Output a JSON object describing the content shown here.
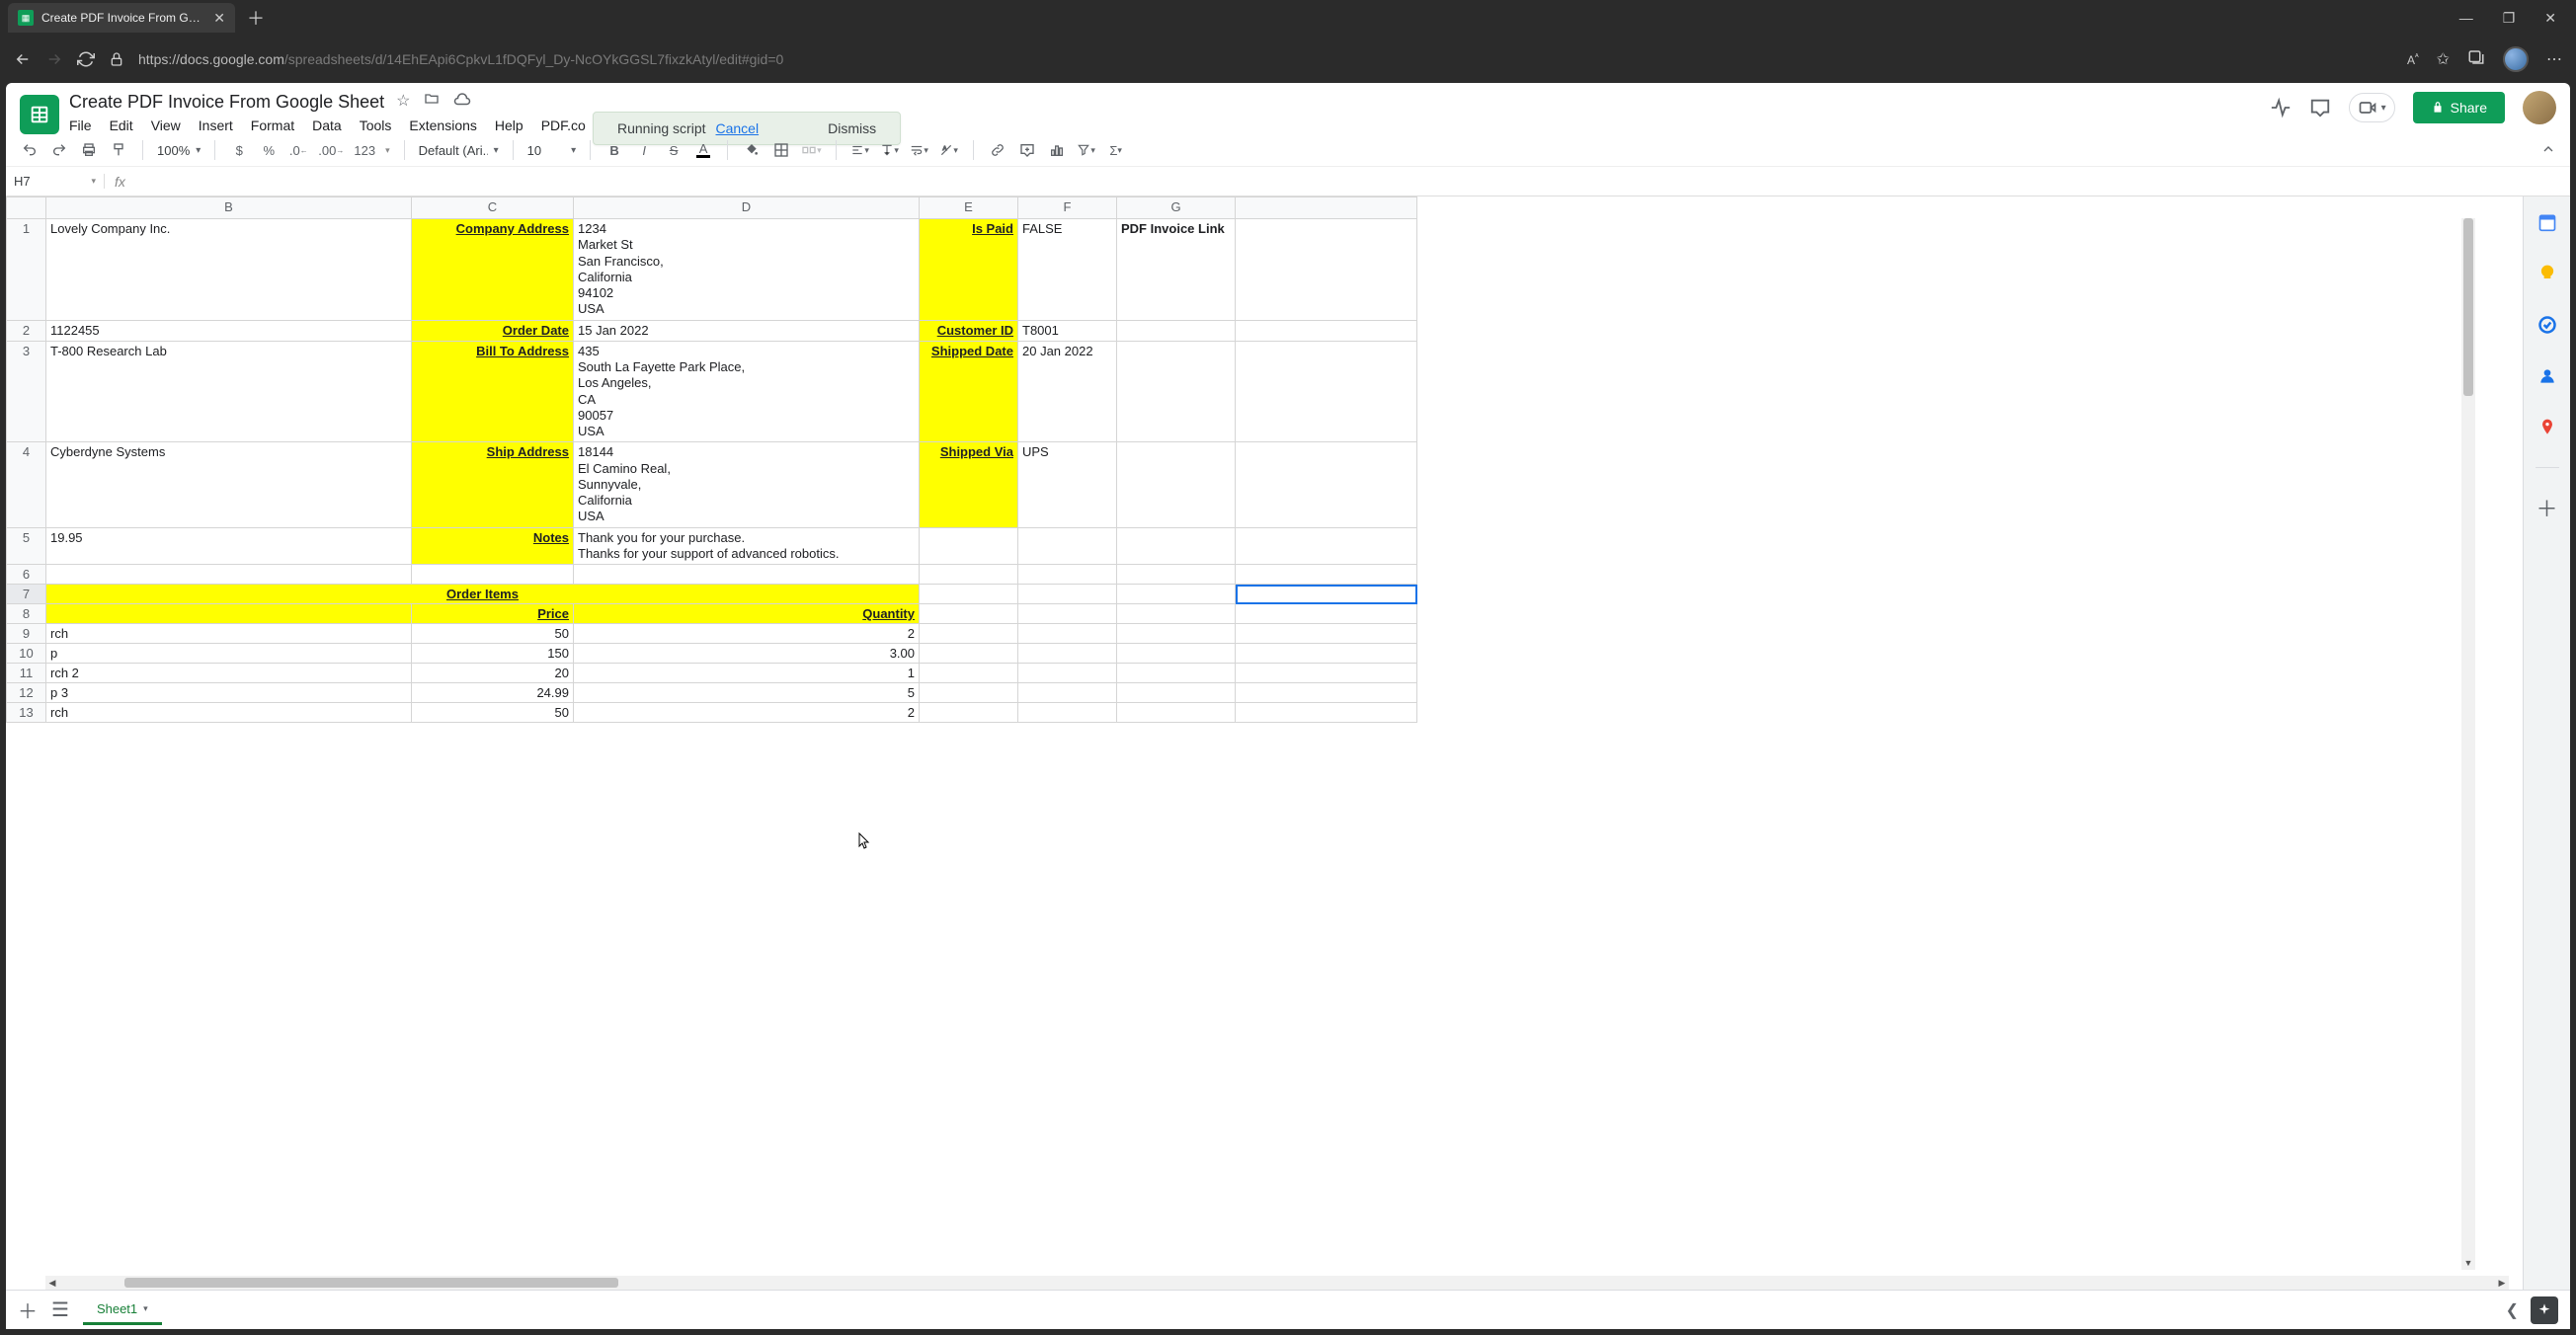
{
  "browser": {
    "tab_title": "Create PDF Invoice From Google",
    "url_prefix": "https://",
    "url_host": "docs.google.com",
    "url_path": "/spreadsheets/d/14EhEApi6CpkvL1fDQFyl_Dy-NcOYkGGSL7fixzkAtyl/edit#gid=0"
  },
  "doc": {
    "title": "Create PDF Invoice From Google Sheet",
    "menus": [
      "File",
      "Edit",
      "View",
      "Insert",
      "Format",
      "Data",
      "Tools",
      "Extensions",
      "Help",
      "PDF.co"
    ],
    "share_label": "Share"
  },
  "toast": {
    "running": "Running script",
    "cancel": "Cancel",
    "dismiss": "Dismiss"
  },
  "toolbar": {
    "zoom": "100%",
    "font": "Default (Ari...",
    "size": "10",
    "num_fmt": "123"
  },
  "formula": {
    "cell_ref": "H7",
    "value": ""
  },
  "columns": [
    "B",
    "C",
    "D",
    "E",
    "F",
    "G"
  ],
  "rows": [
    {
      "n": "1",
      "b": "Lovely Company Inc.",
      "c": "Company Address",
      "c_hl": true,
      "d": "1234\nMarket St\nSan Francisco,\nCalifornia\n94102\nUSA",
      "e": "Is Paid",
      "e_hl": true,
      "f": "FALSE",
      "g": "PDF Invoice Link",
      "g_bold": true
    },
    {
      "n": "2",
      "b": "1122455",
      "c": "Order Date",
      "c_hl": true,
      "d": "15 Jan 2022",
      "e": "Customer ID",
      "e_hl": true,
      "f": "T8001",
      "g": ""
    },
    {
      "n": "3",
      "b": "T-800 Research Lab",
      "c": "Bill To Address",
      "c_hl": true,
      "d": "435\nSouth La Fayette Park Place,\nLos Angeles,\nCA\n90057\nUSA",
      "e": "Shipped Date",
      "e_hl": true,
      "f": "20 Jan 2022",
      "g": ""
    },
    {
      "n": "4",
      "b": "Cyberdyne Systems",
      "c": "Ship Address",
      "c_hl": true,
      "d": "18144\nEl Camino Real,\nSunnyvale,\nCalifornia\nUSA",
      "e": "Shipped Via",
      "e_hl": true,
      "f": "UPS",
      "g": ""
    },
    {
      "n": "5",
      "b": "19.95",
      "c": "Notes",
      "c_hl": true,
      "d": "Thank you for your purchase.\nThanks for your support of advanced robotics.",
      "e": "",
      "e_hl": false,
      "f": "",
      "g": ""
    },
    {
      "n": "6",
      "b": "",
      "c": "",
      "d": "",
      "e": "",
      "f": "",
      "g": ""
    },
    {
      "n": "7",
      "b": "Order Items",
      "b_span": true,
      "active_h": true
    },
    {
      "n": "8",
      "b": "",
      "c": "Price",
      "c_hl": true,
      "d": "Quantity",
      "d_hl": true,
      "e": "",
      "f": "",
      "g": ""
    },
    {
      "n": "9",
      "b": "rch",
      "c": "50",
      "c_r": true,
      "d": "2",
      "d_r": true,
      "e": "",
      "f": "",
      "g": ""
    },
    {
      "n": "10",
      "b": "p",
      "c": "150",
      "c_r": true,
      "d": "3.00",
      "d_r": true,
      "e": "",
      "f": "",
      "g": ""
    },
    {
      "n": "11",
      "b": "rch 2",
      "c": "20",
      "c_r": true,
      "d": "1",
      "d_r": true,
      "e": "",
      "f": "",
      "g": ""
    },
    {
      "n": "12",
      "b": "p 3",
      "c": "24.99",
      "c_r": true,
      "d": "5",
      "d_r": true,
      "e": "",
      "f": "",
      "g": ""
    },
    {
      "n": "13",
      "b": "rch",
      "c": "50",
      "c_r": true,
      "d": "2",
      "d_r": true,
      "e": "",
      "f": "",
      "g": "",
      "cut": true
    }
  ],
  "sheet_tab": "Sheet1"
}
